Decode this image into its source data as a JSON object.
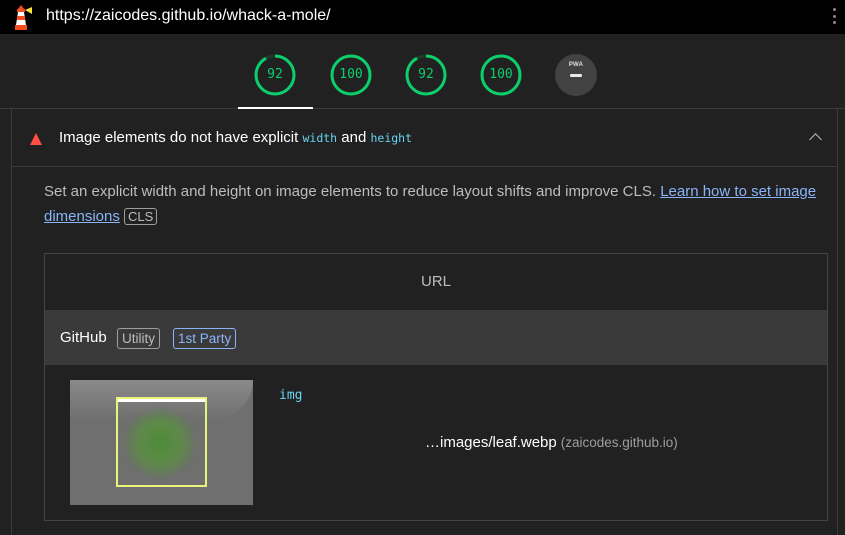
{
  "topbar": {
    "url": "https://zaicodes.github.io/whack-a-mole/"
  },
  "scores": [
    {
      "value": "92",
      "fraction": 0.92
    },
    {
      "value": "100",
      "fraction": 1.0
    },
    {
      "value": "92",
      "fraction": 0.92
    },
    {
      "value": "100",
      "fraction": 1.0
    }
  ],
  "pwa": {
    "label": "PWA"
  },
  "colors": {
    "pass": "#0cce6b",
    "fail": "#ff4e42",
    "link": "#8ab4f8",
    "code": "#67d4f2"
  },
  "audit": {
    "title_prefix": "Image elements do not have explicit ",
    "title_code1": "width",
    "title_and": " and ",
    "title_code2": "height",
    "description": "Set an explicit width and height on image elements to reduce layout shifts and improve CLS. ",
    "link_text": "Learn how to set image dimensions",
    "tag": "CLS"
  },
  "table": {
    "header": "URL",
    "group": {
      "entity": "GitHub",
      "badge1": "Utility",
      "badge2": "1st Party"
    },
    "rows": [
      {
        "node": "img",
        "url": "…images/leaf.webp",
        "host": "(zaicodes.github.io)"
      }
    ]
  }
}
